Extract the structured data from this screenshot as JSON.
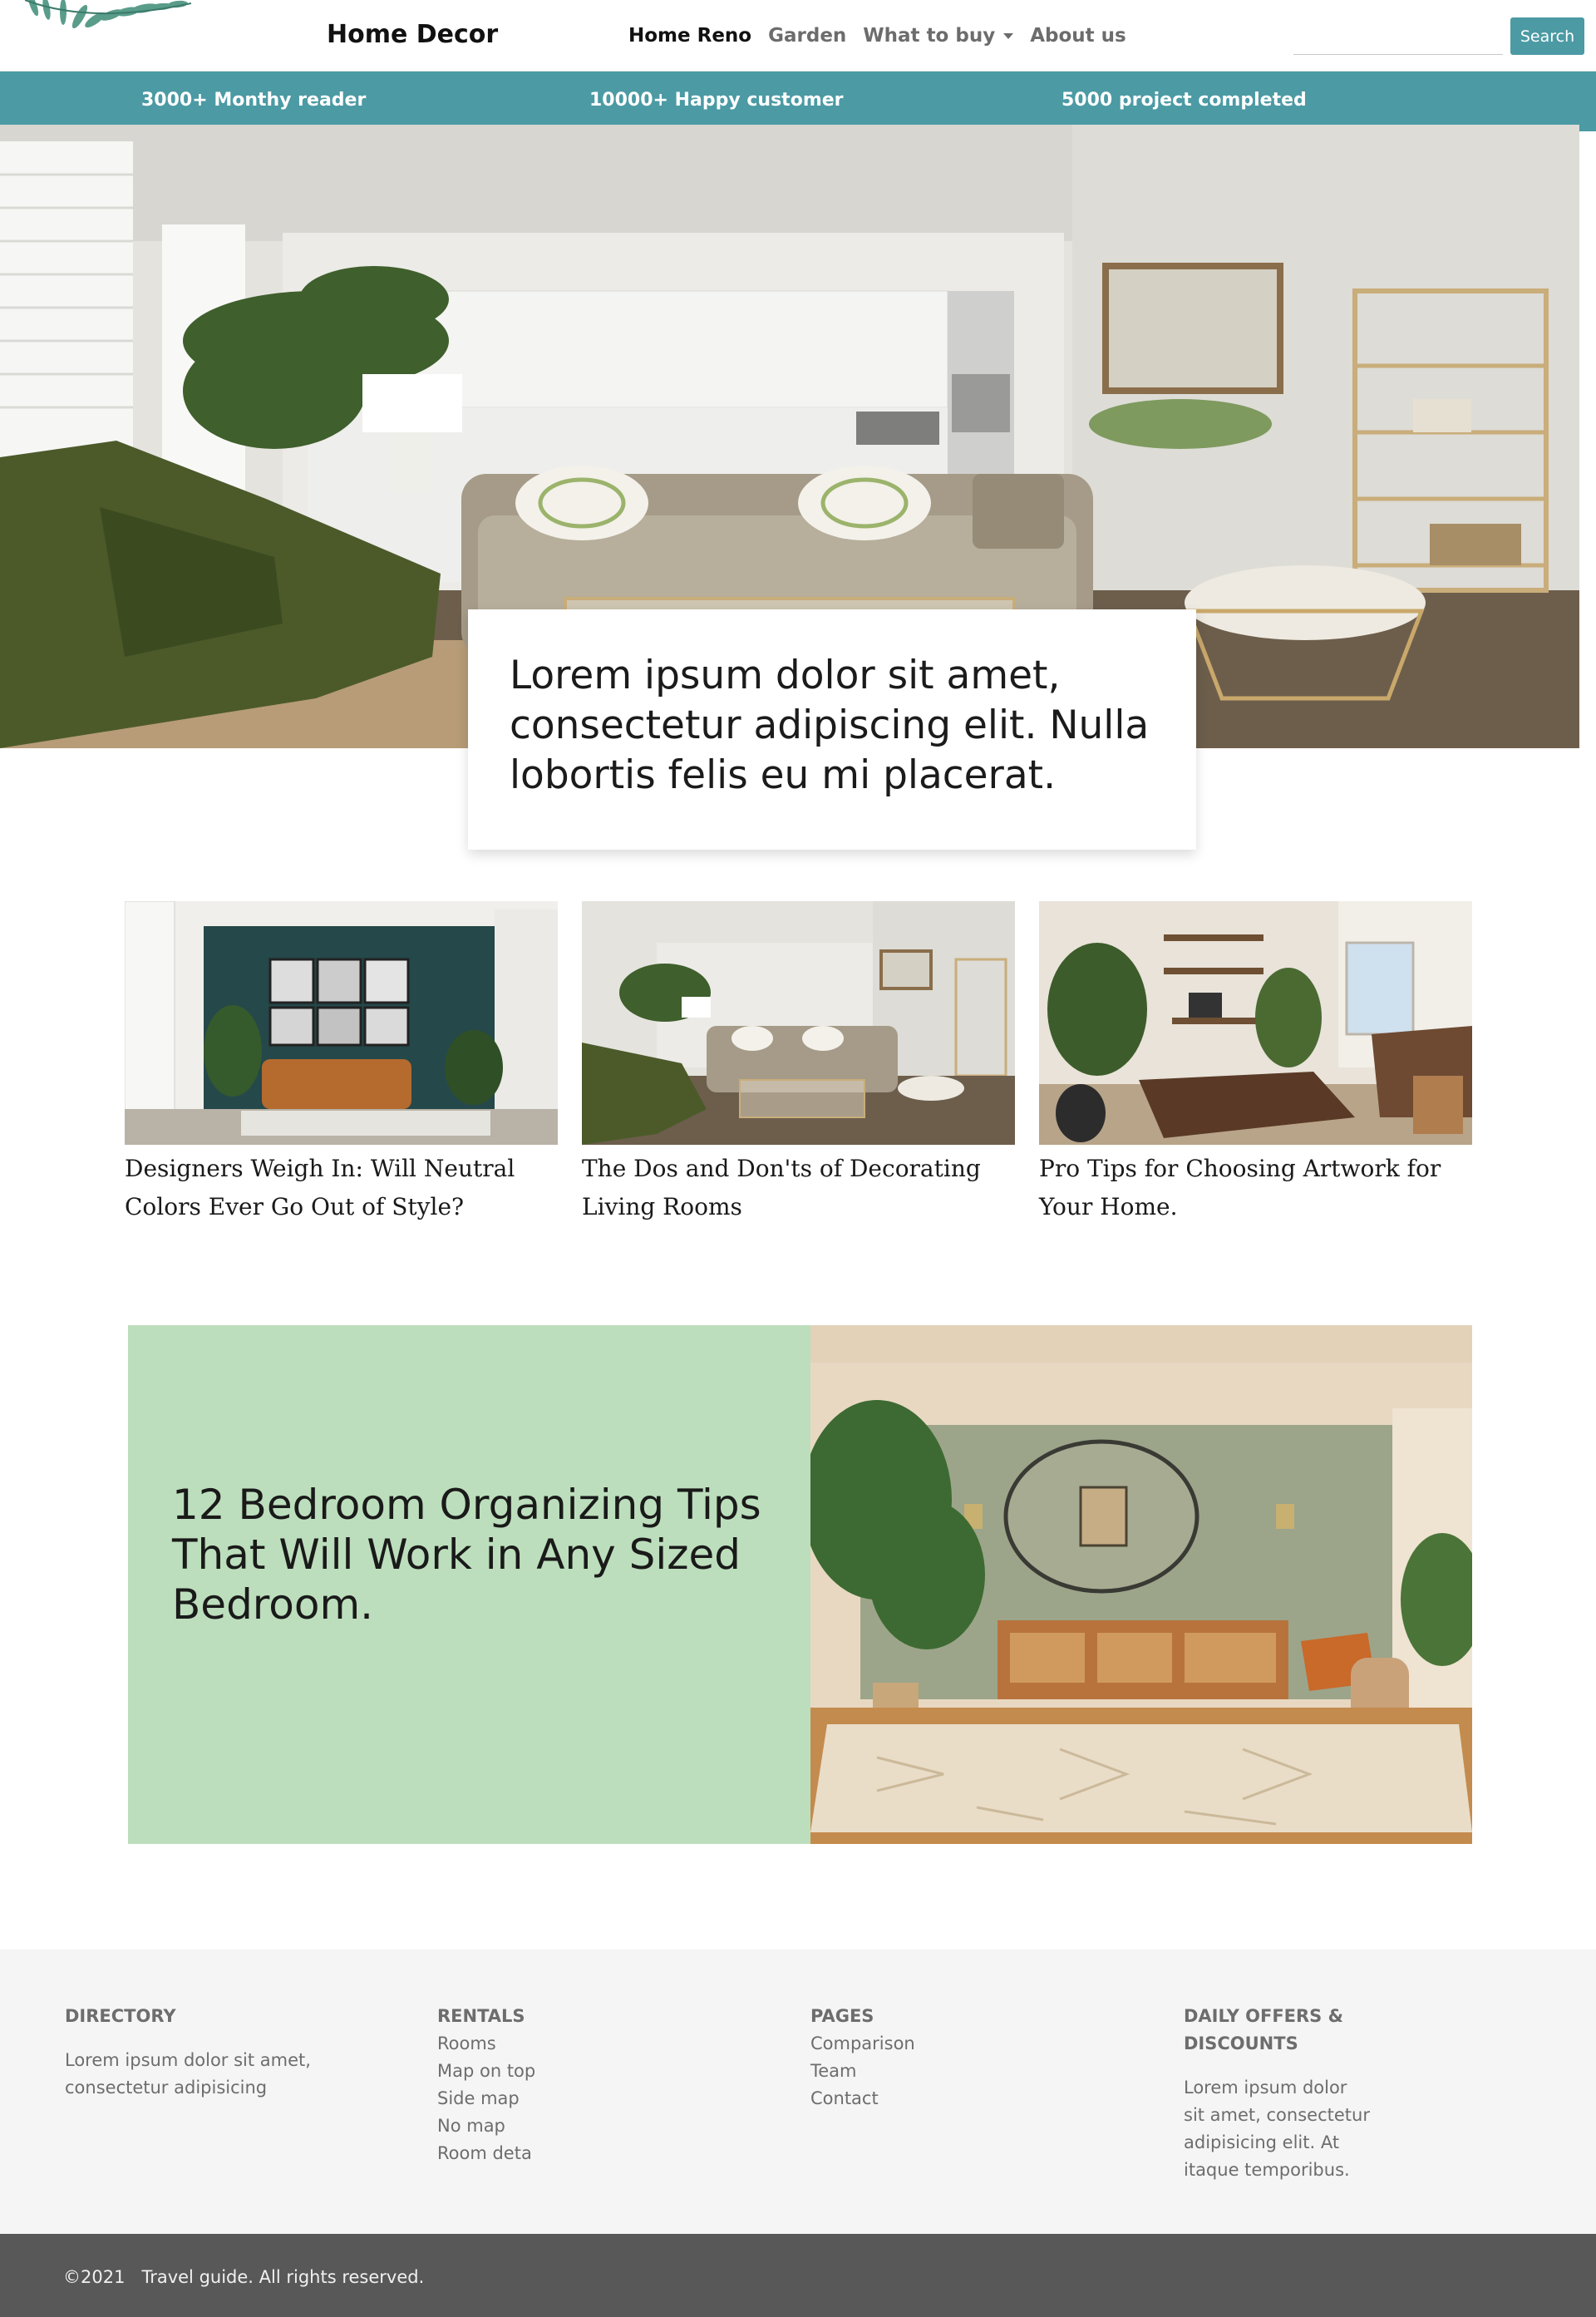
{
  "navbar": {
    "brand": "Home Decor",
    "links": [
      {
        "label": "Home Reno"
      },
      {
        "label": "Garden"
      },
      {
        "label": "What to buy"
      },
      {
        "label": "About us"
      }
    ],
    "search_placeholder": "",
    "search_button": "Search"
  },
  "stats": [
    {
      "label": "3000+ Monthy reader"
    },
    {
      "label": "10000+ Happy customer"
    },
    {
      "label": "5000 project completed"
    }
  ],
  "hero": {
    "headline": "Lorem ipsum dolor sit amet, consectetur adipiscing elit. Nulla lobortis felis eu mi placerat.",
    "image": "living-room-photo"
  },
  "articles": [
    {
      "title": "Designers Weigh In: Will Neutral Colors Ever Go Out of Style?",
      "image": "teal-wall-living-room-photo"
    },
    {
      "title": "The Dos and Don'ts of Decorating Living Rooms",
      "image": "living-room-photo"
    },
    {
      "title": "Pro Tips for Choosing Artwork for Your Home.",
      "image": "home-office-photo"
    }
  ],
  "feature": {
    "title": "12 Bedroom Organizing Tips That Will Work in Any Sized Bedroom.",
    "image": "sage-wall-room-photo"
  },
  "footer": {
    "directory": {
      "heading": "DIRECTORY",
      "text": "Lorem ipsum dolor sit amet, consectetur adipisicing"
    },
    "rentals": {
      "heading": "RENTALS",
      "links": [
        "Rooms",
        "Map on top",
        "Side map",
        "No map",
        "Room deta"
      ]
    },
    "pages": {
      "heading": "PAGES",
      "links": [
        "Comparison",
        "Team",
        "Contact"
      ]
    },
    "offers": {
      "heading": "DAILY OFFERS & DISCOUNTS",
      "text": "Lorem ipsum dolor sit amet, consectetur adipisicing elit. At itaque temporibus."
    },
    "copyright": "©2021   Travel guide. All rights reserved."
  },
  "colors": {
    "accent": "#4b9aa4",
    "feature_bg": "#bcdebc",
    "footer_bg": "#f5f5f5",
    "copyright_bg": "#585858"
  }
}
